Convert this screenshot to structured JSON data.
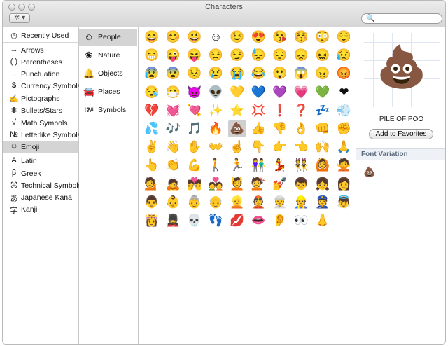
{
  "window": {
    "title": "Characters"
  },
  "toolbar": {
    "gear_glyph": "✲ ▾",
    "search_placeholder": ""
  },
  "categories": [
    {
      "glyph": "◷",
      "label": "Recently Used",
      "selected": false
    },
    {
      "glyph": "→",
      "label": "Arrows",
      "selected": false
    },
    {
      "glyph": "( )",
      "label": "Parentheses",
      "selected": false
    },
    {
      "glyph": ",,",
      "label": "Punctuation",
      "selected": false
    },
    {
      "glyph": "$",
      "label": "Currency Symbols",
      "selected": false
    },
    {
      "glyph": "✍",
      "label": "Pictographs",
      "selected": false
    },
    {
      "glyph": "✻",
      "label": "Bullets/Stars",
      "selected": false
    },
    {
      "glyph": "√",
      "label": "Math Symbols",
      "selected": false
    },
    {
      "glyph": "№",
      "label": "Letterlike Symbols",
      "selected": false
    },
    {
      "glyph": "☺",
      "label": "Emoji",
      "selected": true
    },
    {
      "glyph": "A",
      "label": "Latin",
      "selected": false
    },
    {
      "glyph": "β",
      "label": "Greek",
      "selected": false
    },
    {
      "glyph": "⌘",
      "label": "Technical Symbols",
      "selected": false
    },
    {
      "glyph": "あ",
      "label": "Japanese Kana",
      "selected": false
    },
    {
      "glyph": "字",
      "label": "Kanji",
      "selected": false
    }
  ],
  "subcategories": [
    {
      "glyph": "☺",
      "label": "People",
      "selected": true
    },
    {
      "glyph": "❀",
      "label": "Nature",
      "selected": false
    },
    {
      "glyph": "🔔",
      "label": "Objects",
      "selected": false
    },
    {
      "glyph": "🚘",
      "label": "Places",
      "selected": false
    },
    {
      "glyph": "!?#",
      "label": "Symbols",
      "selected": false
    }
  ],
  "emoji_rows": [
    [
      "😄",
      "😊",
      "😃",
      "☺",
      "😉",
      "😍",
      "😘",
      "😚",
      "😳",
      "😌"
    ],
    [
      "😁",
      "😜",
      "😝",
      "😒",
      "😏",
      "😓",
      "😔",
      "😞",
      "😖",
      "😥"
    ],
    [
      "😰",
      "😨",
      "😣",
      "😢",
      "😭",
      "😂",
      "😲",
      "😱",
      "😠",
      "😡"
    ],
    [
      "😪",
      "😷",
      "👿",
      "👽",
      "💛",
      "💙",
      "💜",
      "💗",
      "💚",
      "❤"
    ],
    [
      "💔",
      "💓",
      "💘",
      "✨",
      "⭐",
      "💢",
      "❗",
      "❓",
      "💤",
      "💨"
    ],
    [
      "💦",
      "🎶",
      "🎵",
      "🔥",
      "💩",
      "👍",
      "👎",
      "👌",
      "👊",
      "✊"
    ],
    [
      "✌",
      "👋",
      "✋",
      "👐",
      "☝",
      "👇",
      "👉",
      "👈",
      "🙌",
      "🙏"
    ],
    [
      "👆",
      "👏",
      "💪",
      "🚶",
      "🏃",
      "👫",
      "💃",
      "👯",
      "🙆",
      "🙅"
    ],
    [
      "💁",
      "🙇",
      "💏",
      "💑",
      "💆",
      "💇",
      "💅",
      "👦",
      "👧",
      "👩"
    ],
    [
      "👨",
      "👶",
      "👵",
      "👴",
      "👱",
      "👲",
      "👳",
      "👷",
      "👮",
      "👼"
    ],
    [
      "👸",
      "💂",
      "💀",
      "👣",
      "💋",
      "👄",
      "👂",
      "👀",
      "👃"
    ]
  ],
  "selected_cell": {
    "row": 5,
    "col": 4
  },
  "detail": {
    "glyph": "💩",
    "name": "PILE OF POO",
    "add_button": "Add to Favorites",
    "font_variation_label": "Font Variation",
    "variation_glyph": "💩"
  }
}
